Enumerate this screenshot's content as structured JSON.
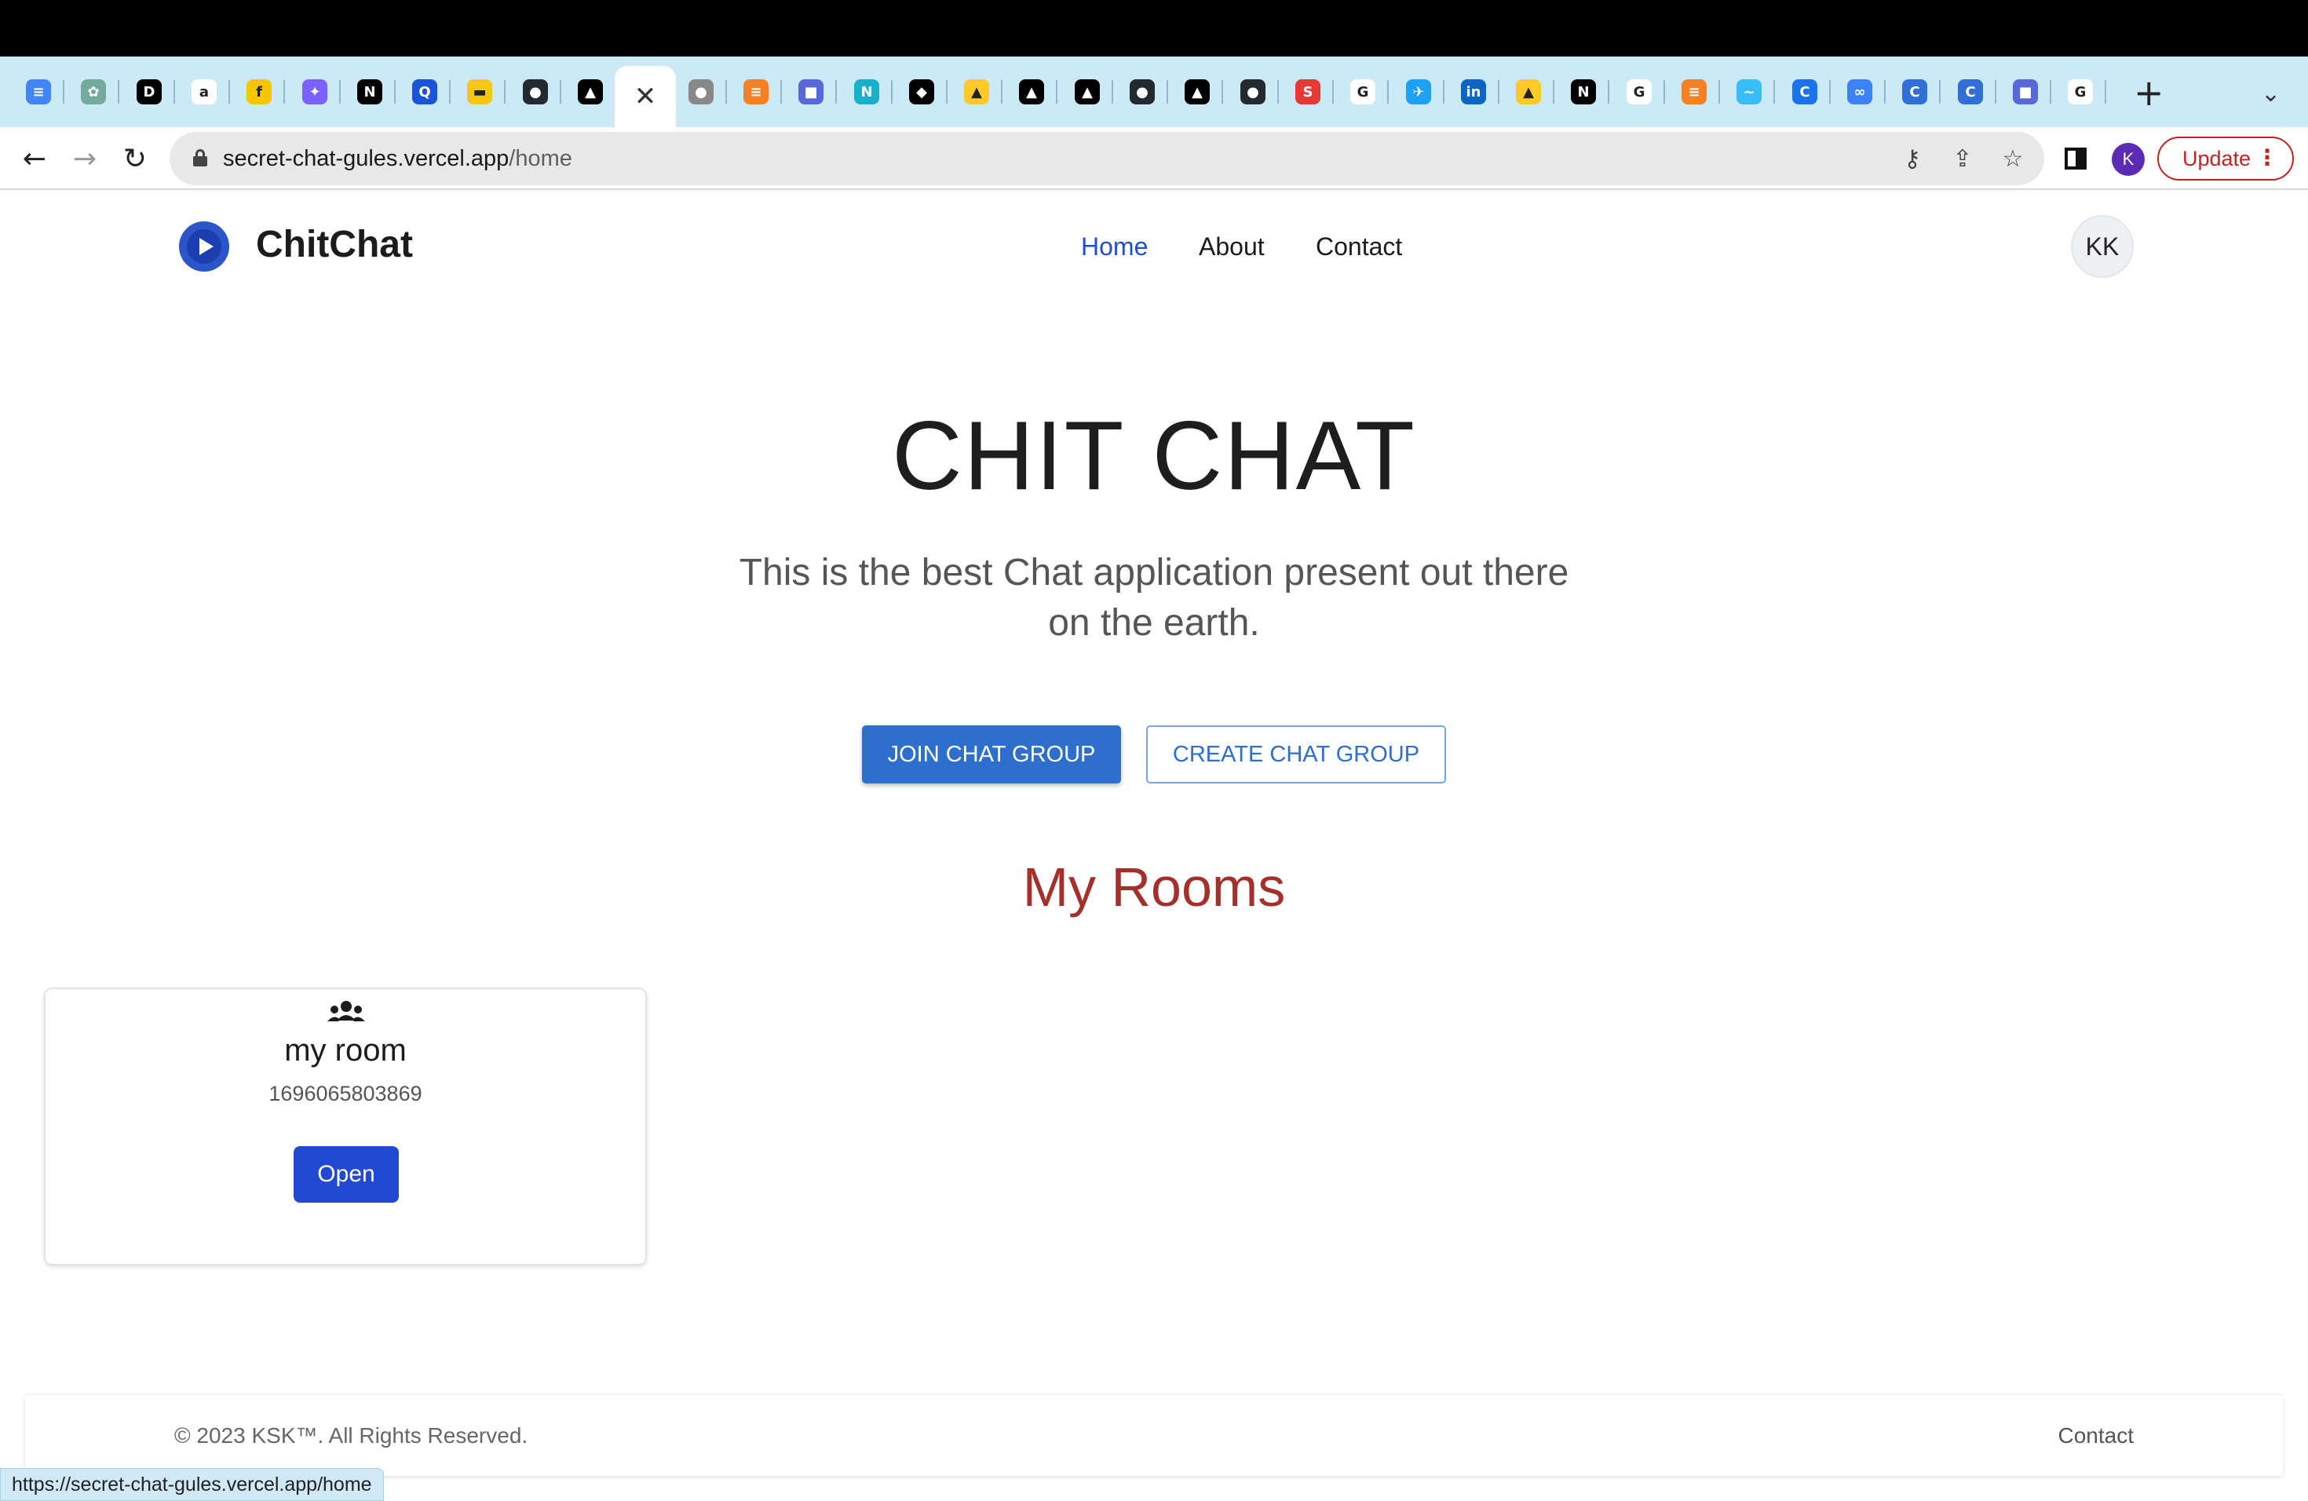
{
  "browser": {
    "tabs": [
      {
        "icon": "google-docs-icon",
        "color": "#4285f4",
        "glyph": "≡"
      },
      {
        "icon": "chatgpt-icon",
        "color": "#74aa9c",
        "glyph": "✿"
      },
      {
        "icon": "dev-to-icon",
        "color": "#000000",
        "glyph": "D"
      },
      {
        "icon": "amazon-icon",
        "color": "#ffffff",
        "glyph": "a"
      },
      {
        "icon": "flipkart-icon",
        "color": "#f7c600",
        "glyph": "f"
      },
      {
        "icon": "gemini-icon",
        "color": "#7b61ff",
        "glyph": "✦"
      },
      {
        "icon": "nextjs-icon",
        "color": "#000000",
        "glyph": "N"
      },
      {
        "icon": "search-icon",
        "color": "#1a55d6",
        "glyph": "Q"
      },
      {
        "icon": "imdb-icon",
        "color": "#f5c518",
        "glyph": "▬"
      },
      {
        "icon": "github-icon",
        "color": "#24292f",
        "glyph": "●"
      },
      {
        "icon": "vercel-icon",
        "color": "#000000",
        "glyph": "▲"
      },
      {
        "icon": "active-tab-close-icon",
        "color": "#ffffff",
        "glyph": "✕"
      },
      {
        "icon": "apple-icon",
        "color": "#888888",
        "glyph": "●"
      },
      {
        "icon": "stackoverflow-icon",
        "color": "#f48024",
        "glyph": "≡"
      },
      {
        "icon": "printer-icon",
        "color": "#5a67d8",
        "glyph": "■"
      },
      {
        "icon": "n-logo-icon",
        "color": "#1ab0c9",
        "glyph": "N"
      },
      {
        "icon": "codepen-icon",
        "color": "#000000",
        "glyph": "◆"
      },
      {
        "icon": "firebase-icon",
        "color": "#ffca28",
        "glyph": "▲"
      },
      {
        "icon": "vercel-icon",
        "color": "#000000",
        "glyph": "▲"
      },
      {
        "icon": "vercel-icon",
        "color": "#000000",
        "glyph": "▲"
      },
      {
        "icon": "github-icon",
        "color": "#24292f",
        "glyph": "●"
      },
      {
        "icon": "vercel-icon",
        "color": "#000000",
        "glyph": "▲"
      },
      {
        "icon": "github-icon",
        "color": "#24292f",
        "glyph": "●"
      },
      {
        "icon": "s-logo-icon",
        "color": "#e53935",
        "glyph": "S"
      },
      {
        "icon": "google-icon",
        "color": "#ffffff",
        "glyph": "G"
      },
      {
        "icon": "twitter-icon",
        "color": "#1da1f2",
        "glyph": "✈"
      },
      {
        "icon": "linkedin-icon",
        "color": "#0a66c2",
        "glyph": "in"
      },
      {
        "icon": "firebase-icon",
        "color": "#ffca28",
        "glyph": "▲"
      },
      {
        "icon": "nextjs-icon",
        "color": "#000000",
        "glyph": "N"
      },
      {
        "icon": "google-icon",
        "color": "#ffffff",
        "glyph": "G"
      },
      {
        "icon": "stackoverflow-icon",
        "color": "#f48024",
        "glyph": "≡"
      },
      {
        "icon": "tailwind-icon",
        "color": "#38bdf8",
        "glyph": "~"
      },
      {
        "icon": "c-logo-icon",
        "color": "#1a73e8",
        "glyph": "C"
      },
      {
        "icon": "link-icon",
        "color": "#3b82f6",
        "glyph": "∞"
      },
      {
        "icon": "c-logo-icon",
        "color": "#2f6fd6",
        "glyph": "C"
      },
      {
        "icon": "c-logo-icon",
        "color": "#2f6fd6",
        "glyph": "C"
      },
      {
        "icon": "printer-icon",
        "color": "#5a67d8",
        "glyph": "■"
      },
      {
        "icon": "google-icon",
        "color": "#ffffff",
        "glyph": "G"
      }
    ],
    "url_host": "secret-chat-gules.vercel.app",
    "url_path": "/home",
    "profile_initial": "K",
    "update_label": "Update",
    "status_url": "https://secret-chat-gules.vercel.app/home"
  },
  "navbar": {
    "brand": "ChitChat",
    "links": [
      "Home",
      "About",
      "Contact"
    ],
    "active_link": "Home",
    "avatar_initials": "KK"
  },
  "hero": {
    "title": "CHIT CHAT",
    "subtitle": "This is the best Chat application present out there on the earth.",
    "join_button": "JOIN CHAT GROUP",
    "create_button": "CREATE CHAT GROUP"
  },
  "rooms": {
    "heading": "My Rooms",
    "items": [
      {
        "name": "my room",
        "id": "1696065803869",
        "open_label": "Open"
      }
    ]
  },
  "footer": {
    "copyright": "© 2023 KSK™. All Rights Reserved.",
    "contact": "Contact"
  },
  "colors": {
    "accent": "#1f4fd1",
    "button_primary": "#2e6fce",
    "rooms_heading": "#a3302b",
    "tabstrip": "#cbe9f6"
  }
}
